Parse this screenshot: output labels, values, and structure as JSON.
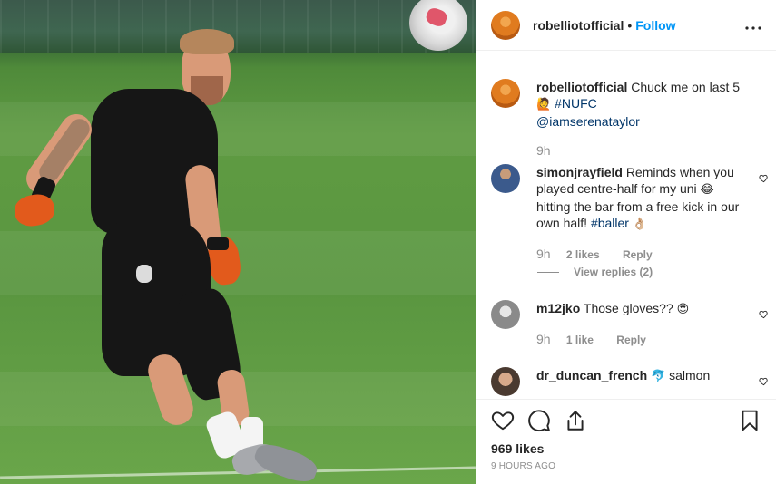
{
  "header": {
    "username": "robelliotofficial",
    "separator": "•",
    "follow_label": "Follow",
    "more_label": "•••"
  },
  "caption": {
    "username": "robelliotofficial",
    "text": "Chuck me on last 5",
    "emoji": "🙋",
    "hashtag": "#NUFC",
    "mention": "@iamserenataylor",
    "time": "9h"
  },
  "comments": [
    {
      "username": "simonjrayfield",
      "text_1": "Reminds when you played centre-half for my uni",
      "emoji_1": "😂",
      "text_2": "hitting the bar from a free kick in our own half!",
      "hashtag": "#baller",
      "emoji_2": "👌🏼",
      "time": "9h",
      "likes": "2 likes",
      "reply_label": "Reply",
      "view_replies": "View replies (2)"
    },
    {
      "username": "m12jko",
      "text": "Those gloves??",
      "emoji": "😍",
      "time": "9h",
      "likes": "1 like",
      "reply_label": "Reply"
    },
    {
      "username": "dr_duncan_french",
      "emoji": "🐬",
      "text": "salmon"
    }
  ],
  "footer": {
    "likes": "969 likes",
    "timestamp": "9 HOURS AGO"
  },
  "icons": {
    "like": "heart-icon",
    "comment": "comment-icon",
    "share": "share-icon",
    "save": "bookmark-icon"
  }
}
